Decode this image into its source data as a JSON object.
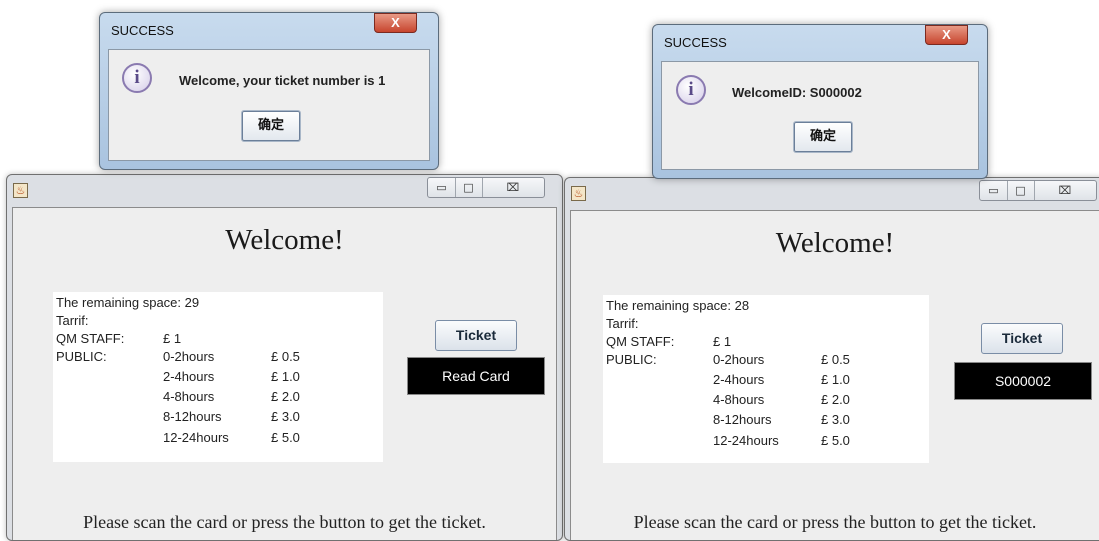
{
  "left_window": {
    "controls": {
      "minimize": "▭",
      "maximize": "□",
      "close": "⌧"
    },
    "welcome": "Welcome!",
    "info": {
      "remaining": "The remaining space: 29",
      "tarrif": "Tarrif:",
      "qm_staff_label": "QM STAFF:",
      "qm_staff_price": "£ 1",
      "public_label": "PUBLIC:",
      "rates": [
        {
          "duration": "0-2hours",
          "price": "£ 0.5"
        },
        {
          "duration": "2-4hours",
          "price": "£ 1.0"
        },
        {
          "duration": "4-8hours",
          "price": "£ 2.0"
        },
        {
          "duration": "8-12hours",
          "price": "£ 3.0"
        },
        {
          "duration": "12-24hours",
          "price": "£ 5.0"
        }
      ]
    },
    "ticket_button": "Ticket",
    "card_field": "Read Card",
    "instruction": "Please scan the card or press the button to get the ticket."
  },
  "right_window": {
    "controls": {
      "minimize": "▭",
      "maximize": "□",
      "close": "⌧"
    },
    "welcome": "Welcome!",
    "info": {
      "remaining": "The remaining space: 28",
      "tarrif": "Tarrif:",
      "qm_staff_label": "QM STAFF:",
      "qm_staff_price": "£ 1",
      "public_label": "PUBLIC:",
      "rates": [
        {
          "duration": "0-2hours",
          "price": "£ 0.5"
        },
        {
          "duration": "2-4hours",
          "price": "£ 1.0"
        },
        {
          "duration": "4-8hours",
          "price": "£ 2.0"
        },
        {
          "duration": "8-12hours",
          "price": "£ 3.0"
        },
        {
          "duration": "12-24hours",
          "price": "£ 5.0"
        }
      ]
    },
    "ticket_button": "Ticket",
    "card_field": "S000002",
    "instruction": "Please scan the card or press the button to get the ticket."
  },
  "left_dialog": {
    "title": "SUCCESS",
    "close": "X",
    "icon": "i",
    "message": "Welcome, your ticket number is 1",
    "ok": "确定"
  },
  "right_dialog": {
    "title": "SUCCESS",
    "close": "X",
    "icon": "i",
    "message": "WelcomeID: S000002",
    "ok": "确定"
  }
}
